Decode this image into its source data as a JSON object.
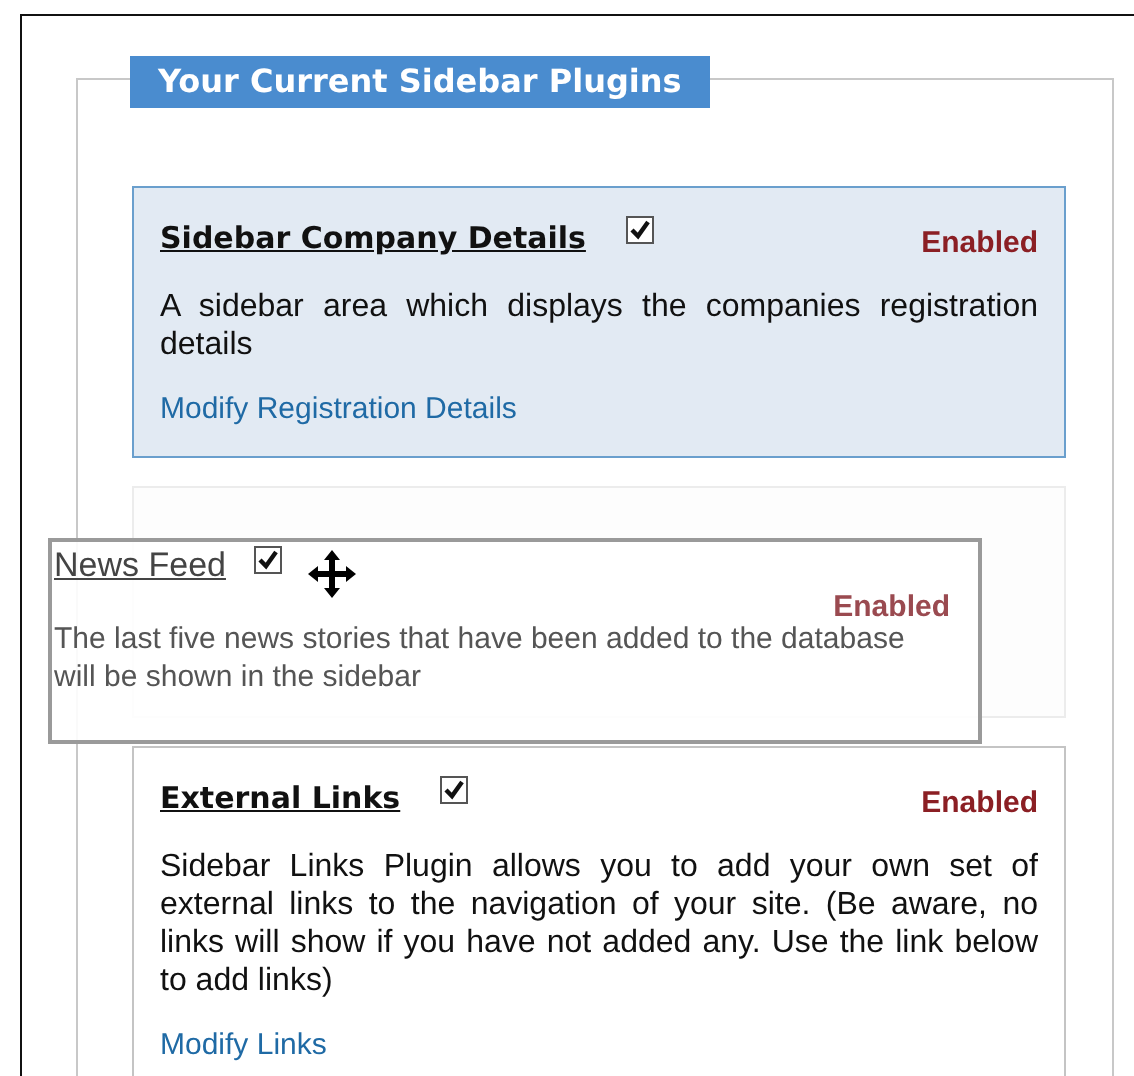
{
  "panel": {
    "title": "Your Current Sidebar Plugins"
  },
  "plugins": [
    {
      "kind": "plugin",
      "name": "Sidebar Company Details",
      "checked": true,
      "status": "Enabled",
      "description": "A sidebar area which displays the companies registration details",
      "link": "Modify Registration Details",
      "selected": true
    },
    {
      "kind": "placeholder"
    },
    {
      "kind": "plugin",
      "name": "External Links",
      "checked": true,
      "status": "Enabled",
      "description": "Sidebar Links Plugin allows you to add your own set of external links to the navigation of your site. (Be aware, no links will show if you have not added any. Use the link below to add links)",
      "link": "Modify Links",
      "selected": false
    }
  ],
  "dragged": {
    "name": "News Feed",
    "checked": true,
    "status": "Enabled",
    "description": "The last five news stories that have been added to the database will be shown in the sidebar"
  }
}
